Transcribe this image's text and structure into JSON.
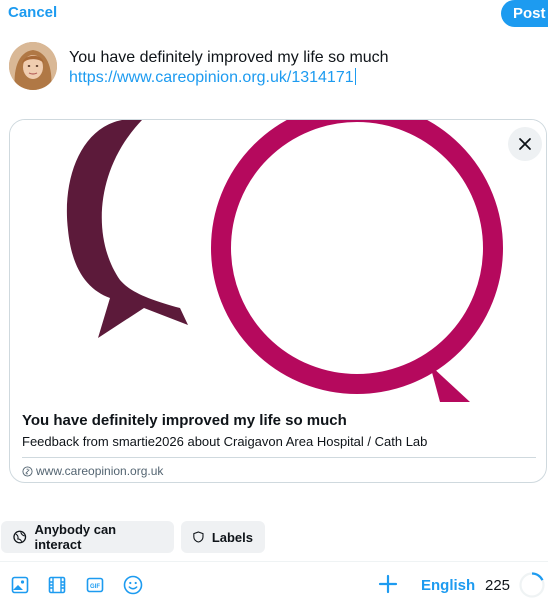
{
  "header": {
    "cancel_label": "Cancel",
    "post_label": "Post"
  },
  "compose": {
    "text": "You have definitely improved my life so much",
    "link": "https://www.careopinion.org.uk/1314171"
  },
  "link_card": {
    "title": "You have definitely improved my life so much",
    "description": "Feedback from smartie2026 about Craigavon Area Hospital / Cath Lab",
    "domain": "www.careopinion.org.uk",
    "image_colors": {
      "dark_bubble": "#5c1a3a",
      "pink_bubble": "#b5095d"
    }
  },
  "chips": {
    "interact_label": "Anybody can interact",
    "labels_label": "Labels"
  },
  "toolbar": {
    "icons": [
      "image-icon",
      "video-icon",
      "gif-icon",
      "emoji-icon",
      "plus-icon"
    ],
    "language": "English",
    "char_remaining": "225",
    "progress_fraction": 0.18
  },
  "colors": {
    "accent": "#1d9bf0",
    "text": "#0f1419",
    "muted": "#536471",
    "border": "#cfd9de"
  }
}
